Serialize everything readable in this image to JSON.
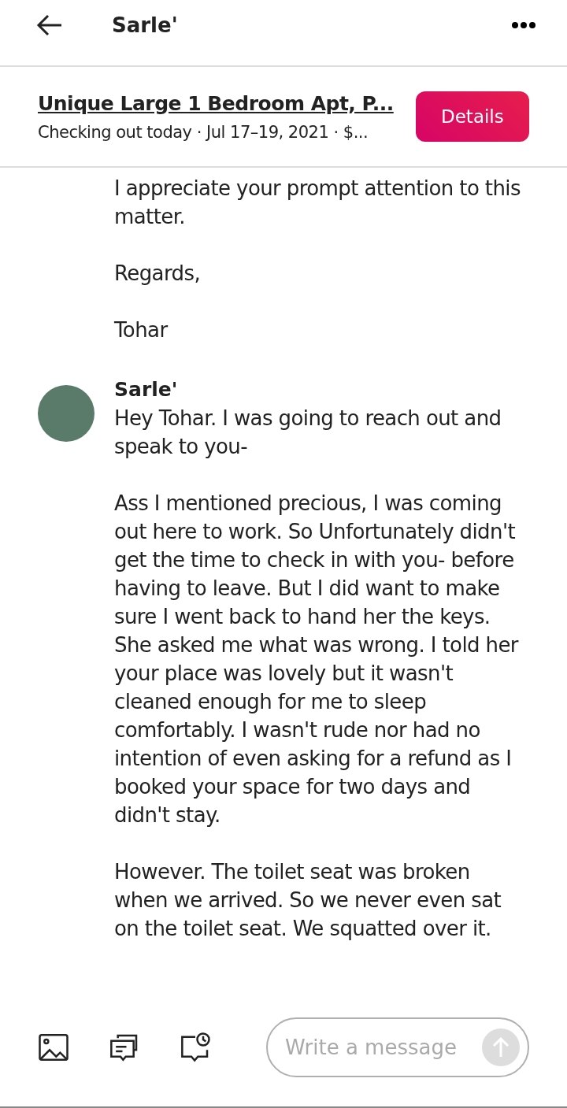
{
  "header": {
    "title": "Sarle'"
  },
  "listing": {
    "title": "Unique Large 1 Bedroom Apt, P...",
    "subtitle": "Checking out today · Jul 17–19, 2021 · $...",
    "button": "Details"
  },
  "messages": [
    {
      "paragraphs": [
        "I appreciate your prompt attention to this matter.",
        "Regards,",
        "Tohar"
      ]
    },
    {
      "sender": "Sarle'",
      "paragraphs": [
        "Hey Tohar. I was going to reach out and speak to you-",
        "Ass I mentioned precious, I was coming out here to work. So Unfortunately didn't get the time to check in with you- before having to leave. But I did want to make sure I went back to hand her the keys. She asked me what was wrong. I told her your place was lovely but it wasn't cleaned enough for me to sleep comfortably. I wasn't rude nor had no intention of even asking for a refund as I booked your space for two days and didn't stay.",
        "However. The toilet seat was broken when we arrived. So we never even sat on the toilet seat. We squatted over it."
      ]
    }
  ],
  "composer": {
    "placeholder": "Write a message"
  }
}
